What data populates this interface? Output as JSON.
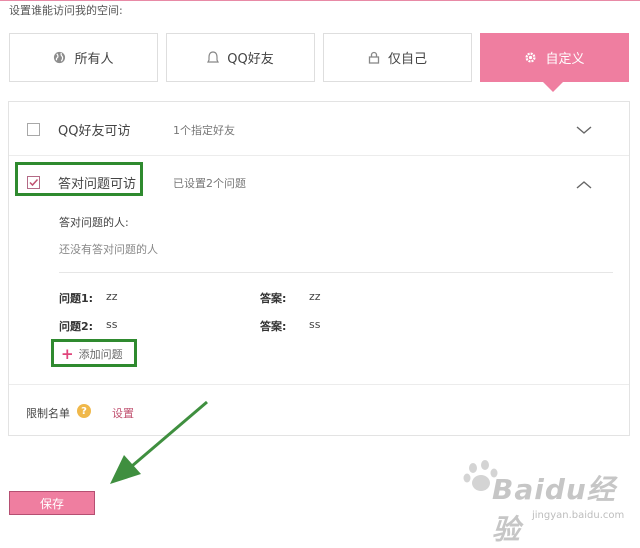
{
  "heading": "设置谁能访问我的空间:",
  "tabs": [
    {
      "label": "所有人",
      "icon": "globe-icon"
    },
    {
      "label": "QQ好友",
      "icon": "bell-icon"
    },
    {
      "label": "仅自己",
      "icon": "lock-icon"
    },
    {
      "label": "自定义",
      "icon": "gear-icon",
      "selected": true
    }
  ],
  "panel": {
    "rows": [
      {
        "title": "QQ好友可访",
        "note": "1个指定好友",
        "checked": false,
        "expanded": false
      },
      {
        "title": "答对问题可访",
        "note": "已设置2个问题",
        "checked": true,
        "expanded": true
      }
    ],
    "answerers_label": "答对问题的人:",
    "answerers_empty": "还没有答对问题的人",
    "questions": [
      {
        "q_label": "问题1:",
        "q_value": "zz",
        "a_label": "答案:",
        "a_value": "zz"
      },
      {
        "q_label": "问题2:",
        "q_value": "ss",
        "a_label": "答案:",
        "a_value": "ss"
      }
    ],
    "add_question": "添加问题",
    "limit_label": "限制名单",
    "limit_help": "?",
    "limit_setting": "设置"
  },
  "save_label": "保存",
  "watermark": {
    "brand": "Baidu经验",
    "url": "jingyan.baidu.com"
  },
  "colors": {
    "accent": "#ef7ea0",
    "highlight": "#2f8a2f",
    "link": "#c0506f",
    "help": "#f0b84a"
  }
}
